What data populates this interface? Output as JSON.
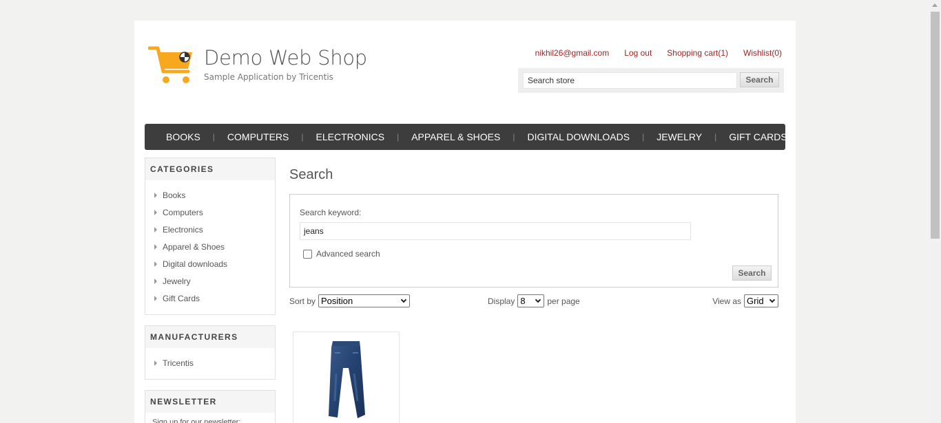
{
  "header": {
    "title": "Demo Web Shop",
    "subtitle": "Sample Application by Tricentis",
    "links": {
      "account": "nikhil26@gmail.com",
      "logout": "Log out",
      "cart": "Shopping cart(1)",
      "wishlist": "Wishlist(0)"
    },
    "search": {
      "value": "Search store",
      "button": "Search"
    }
  },
  "menu": [
    "BOOKS",
    "COMPUTERS",
    "ELECTRONICS",
    "APPAREL & SHOES",
    "DIGITAL DOWNLOADS",
    "JEWELRY",
    "GIFT CARDS"
  ],
  "categories": {
    "title": "CATEGORIES",
    "items": [
      "Books",
      "Computers",
      "Electronics",
      "Apparel & Shoes",
      "Digital downloads",
      "Jewelry",
      "Gift Cards"
    ]
  },
  "manufacturers": {
    "title": "MANUFACTURERS",
    "items": [
      "Tricentis"
    ]
  },
  "newsletter": {
    "title": "NEWSLETTER",
    "text": "Sign up for our newsletter:"
  },
  "main": {
    "page_title": "Search",
    "keyword_label": "Search keyword:",
    "keyword_value": "jeans",
    "advanced_label": "Advanced search",
    "search_button": "Search",
    "sort_label": "Sort by",
    "sort_value": "Position",
    "display_label": "Display",
    "display_value": "8",
    "per_page_label": "per page",
    "view_label": "View as",
    "view_value": "Grid"
  },
  "colors": {
    "link": "#a32121",
    "menu_bg": "#3d3d3d",
    "logo": "#f7a81e"
  }
}
